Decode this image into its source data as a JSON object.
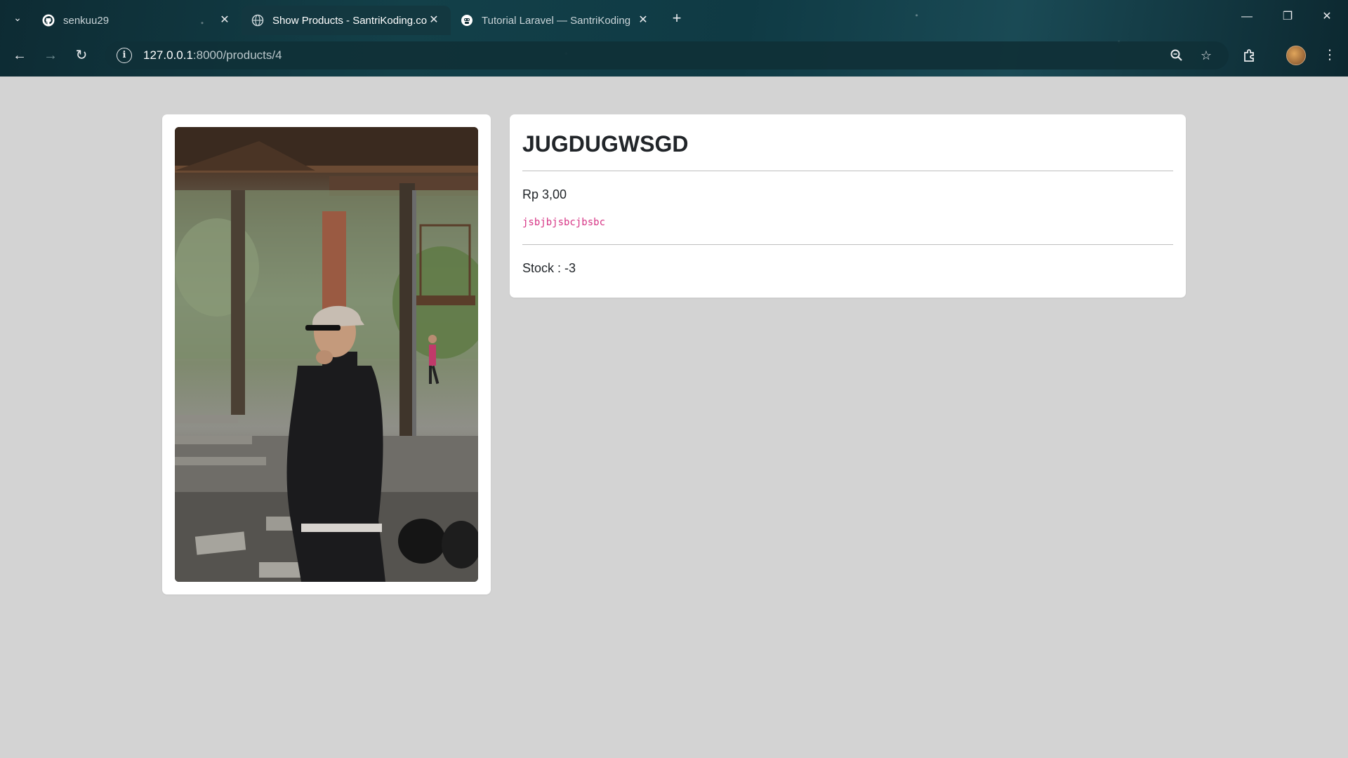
{
  "browser": {
    "tabs": [
      {
        "title": "senkuu29",
        "favicon": "github-icon",
        "active": false
      },
      {
        "title": "Show Products - SantriKoding.com",
        "favicon": "globe-icon",
        "active": true
      },
      {
        "title": "Tutorial Laravel — SantriKoding",
        "favicon": "santrikoding-icon",
        "active": false
      }
    ],
    "url": {
      "host": "127.0.0.1",
      "path": ":8000/products/4"
    },
    "colors": {
      "frame": "#134049",
      "omnibox": "#103038"
    }
  },
  "product": {
    "image_alt": "Product photo",
    "name": "JUGDUGWSGD",
    "price": "Rp 3,00",
    "description": "jsbjbjsbcjbsbc",
    "stock_label": "Stock : ",
    "stock_value": "-3"
  },
  "colors": {
    "page_background": "#d3d3d3",
    "card_background": "#ffffff",
    "description_text": "#d63384"
  }
}
